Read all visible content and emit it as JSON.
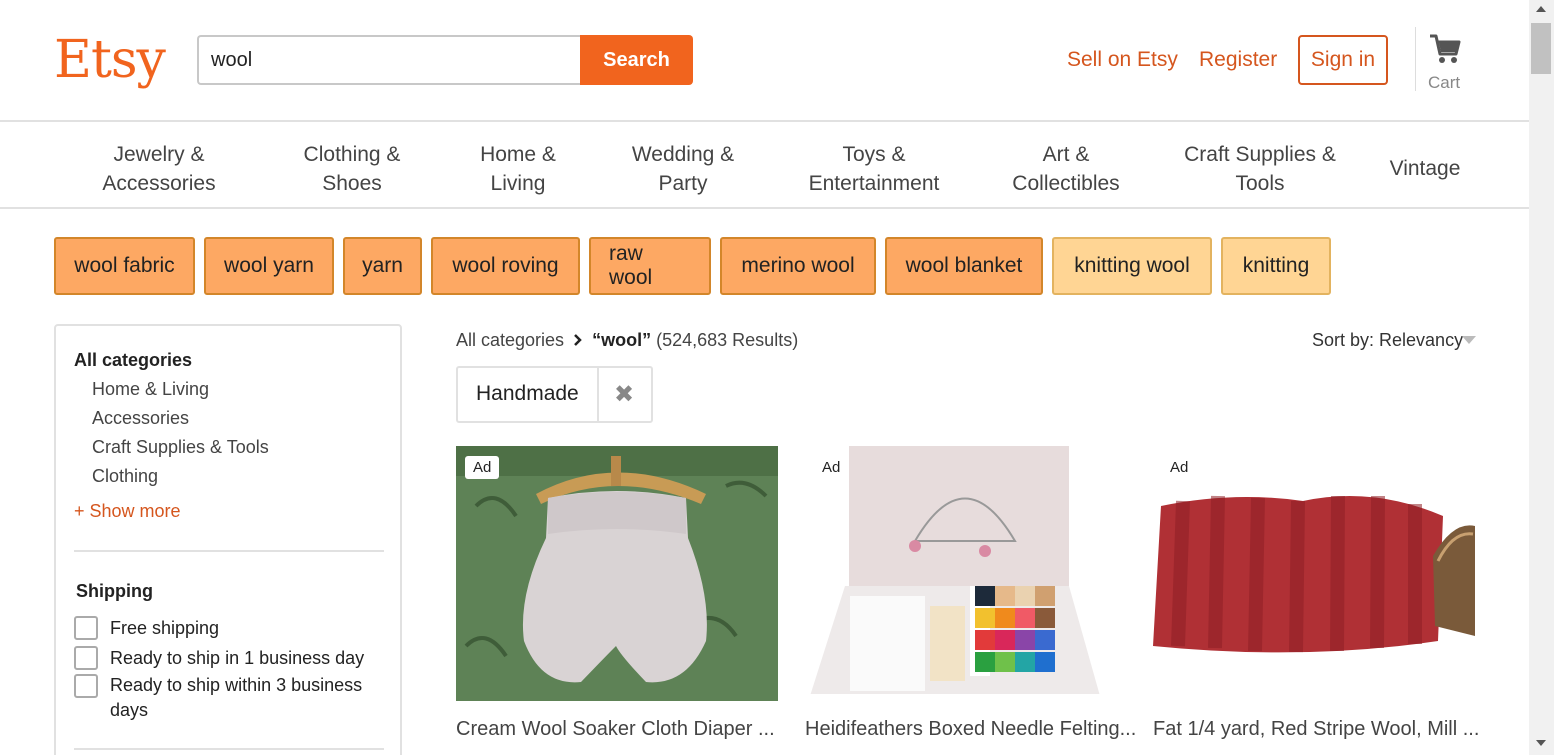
{
  "header": {
    "logo": "Etsy",
    "search_value": "wool",
    "search_button": "Search",
    "sell": "Sell on Etsy",
    "register": "Register",
    "signin": "Sign in",
    "cart": "Cart"
  },
  "nav": [
    "Jewelry &\nAccessories",
    "Clothing &\nShoes",
    "Home &\nLiving",
    "Wedding &\nParty",
    "Toys &\nEntertainment",
    "Art &\nCollectibles",
    "Craft Supplies &\nTools",
    "Vintage"
  ],
  "chips": [
    "wool fabric",
    "wool yarn",
    "yarn",
    "wool roving",
    "raw wool",
    "merino wool",
    "wool blanket",
    "knitting wool",
    "knitting"
  ],
  "sidebar": {
    "all_categories": "All categories",
    "categories": [
      "Home & Living",
      "Accessories",
      "Craft Supplies & Tools",
      "Clothing"
    ],
    "show_more": "+ Show more",
    "shipping_title": "Shipping",
    "shipping_options": [
      "Free shipping",
      "Ready to ship in 1 business day",
      "Ready to ship within 3 business\ndays"
    ]
  },
  "results": {
    "breadcrumb_root": "All categories",
    "breadcrumb_query": "“wool”",
    "breadcrumb_count": "(524,683 Results)",
    "sort": "Sort by: Relevancy",
    "filter": "Handmade",
    "filter_remove": "✖"
  },
  "listings": [
    {
      "ad": "Ad",
      "title": "Cream Wool Soaker Cloth Diaper ..."
    },
    {
      "ad": "Ad",
      "title": "Heidifeathers Boxed Needle Felting..."
    },
    {
      "ad": "Ad",
      "title": "Fat 1/4 yard, Red Stripe Wool, Mill ..."
    }
  ],
  "colors": {
    "brand": "#f1641e",
    "link": "#d5561e",
    "chip": "#fda863",
    "chip_light": "#ffd594"
  }
}
